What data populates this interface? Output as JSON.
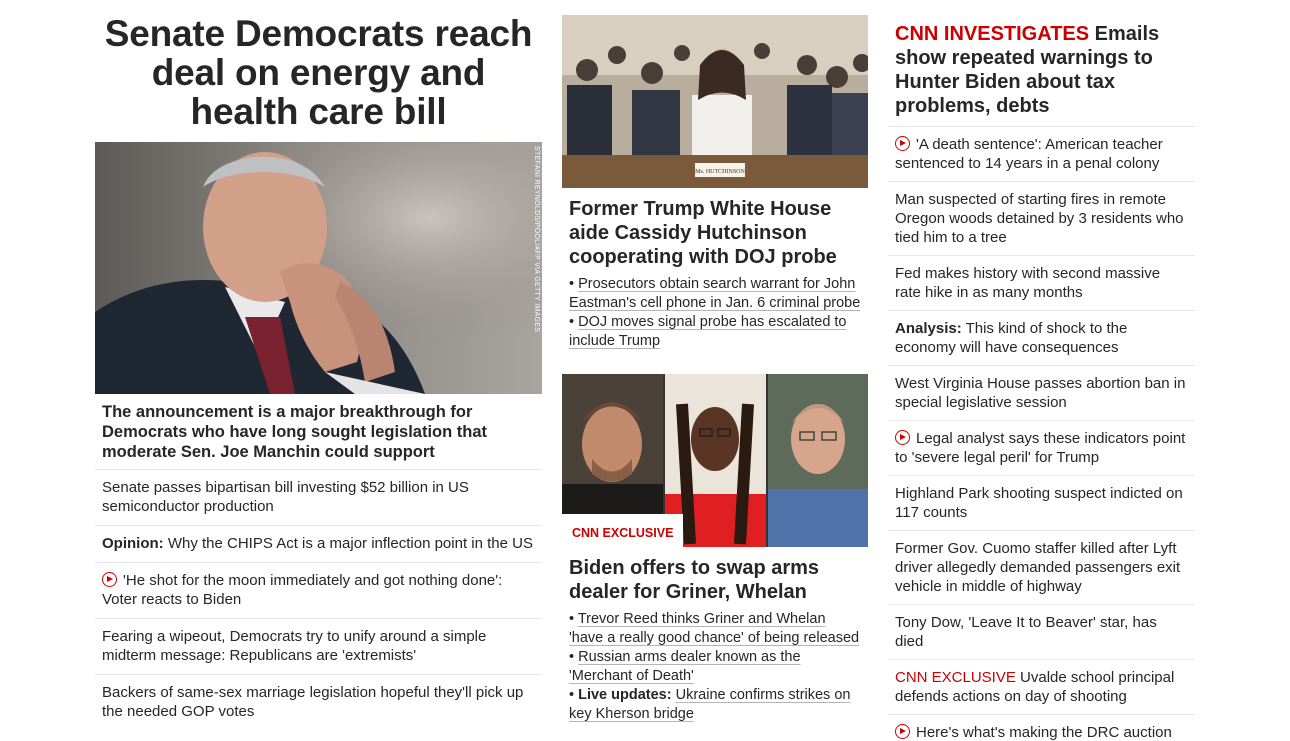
{
  "lead": {
    "headline": "Senate Democrats reach deal on energy and health care bill",
    "photo_credit": "STEFANI REYNOLDS/POOL/AFP VIA GETTY IMAGES",
    "summary": "The announcement is a major breakthrough for Democrats who have long sought legislation that moderate Sen. Joe Manchin could support",
    "items": [
      {
        "prefix": "",
        "text": "Senate passes bipartisan bill investing $52 billion in US semiconductor production",
        "video": false
      },
      {
        "prefix": "Opinion:",
        "text": " Why the CHIPS Act is a major inflection point in the US",
        "video": false
      },
      {
        "prefix": "",
        "text": "'He shot for the moon immediately and got nothing done': Voter reacts to Biden",
        "video": true
      },
      {
        "prefix": "",
        "text": "Fearing a wipeout, Democrats try to unify around a simple midterm message: Republicans are 'extremists'",
        "video": false
      },
      {
        "prefix": "",
        "text": "Backers of same-sex marriage legislation hopeful they'll pick up the needed GOP votes",
        "video": false
      }
    ]
  },
  "story2": {
    "headline": "Former Trump White House aide Cassidy Hutchinson cooperating with DOJ probe",
    "nameplate": "Ms. HUTCHINSON",
    "bullets": [
      {
        "prefix": "",
        "text": "Prosecutors obtain search warrant for John Eastman's cell phone in Jan. 6 criminal probe"
      },
      {
        "prefix": "",
        "text": "DOJ moves signal probe has escalated to include Trump"
      }
    ]
  },
  "story3": {
    "badge": "CNN EXCLUSIVE",
    "headline": "Biden offers to swap arms dealer for Griner, Whelan",
    "bullets": [
      {
        "prefix": "",
        "text": "Trevor Reed thinks Griner and Whelan 'have a really good chance' of being released"
      },
      {
        "prefix": "",
        "text": "Russian arms dealer known as the 'Merchant of Death'"
      },
      {
        "prefix": "Live updates:",
        "text": "Ukraine confirms strikes on key Kherson bridge"
      }
    ]
  },
  "col3": {
    "title_red": "CNN INVESTIGATES",
    "title_rest": " Emails show repeated warnings to Hunter Biden about tax problems, debts",
    "items": [
      {
        "prefix": "",
        "red_prefix": "",
        "text": "'A death sentence': American teacher sentenced to 14 years in a penal colony",
        "video": true
      },
      {
        "prefix": "",
        "red_prefix": "",
        "text": "Man suspected of starting fires in remote Oregon woods detained by 3 residents who tied him to a tree",
        "video": false
      },
      {
        "prefix": "",
        "red_prefix": "",
        "text": "Fed makes history with second massive rate hike in as many months",
        "video": false
      },
      {
        "prefix": "Analysis:",
        "red_prefix": "",
        "text": " This kind of shock to the economy will have consequences",
        "video": false
      },
      {
        "prefix": "",
        "red_prefix": "",
        "text": "West Virginia House passes abortion ban in special legislative session",
        "video": false
      },
      {
        "prefix": "",
        "red_prefix": "",
        "text": "Legal analyst says these indicators point to 'severe legal peril' for Trump",
        "video": true
      },
      {
        "prefix": "",
        "red_prefix": "",
        "text": "Highland Park shooting suspect indicted on 117 counts",
        "video": false
      },
      {
        "prefix": "",
        "red_prefix": "",
        "text": "Former Gov. Cuomo staffer killed after Lyft driver allegedly demanded passengers exit vehicle in middle of highway",
        "video": false
      },
      {
        "prefix": "",
        "red_prefix": "",
        "text": "Tony Dow, 'Leave It to Beaver' star, has died",
        "video": false
      },
      {
        "prefix": "",
        "red_prefix": "CNN EXCLUSIVE",
        "text": " Uvalde school principal defends actions on day of shooting",
        "video": false
      },
      {
        "prefix": "",
        "red_prefix": "",
        "text": "Here's what's making the DRC auction off parts of its rainforest",
        "video": true
      }
    ]
  },
  "colors": {
    "accent": "#cc0000",
    "text": "#262626",
    "divider": "#e6e6e6"
  }
}
